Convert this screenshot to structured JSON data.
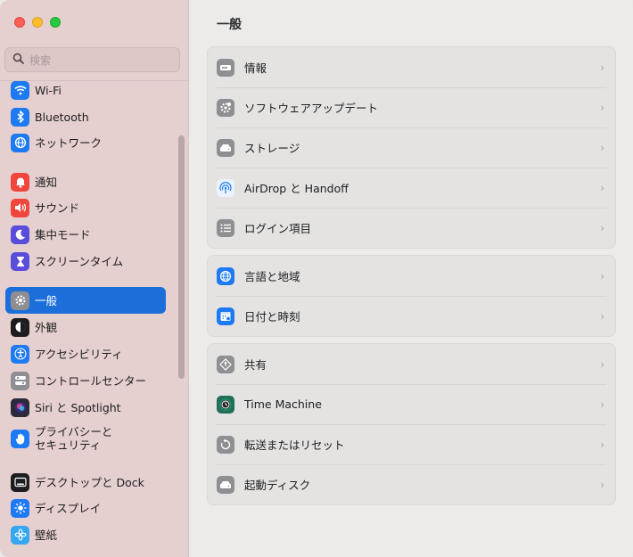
{
  "window": {
    "traffic": [
      "close",
      "minimize",
      "zoom"
    ]
  },
  "sidebar": {
    "search_placeholder": "検索",
    "items": [
      {
        "label": "Wi-Fi",
        "icon": "wifi-icon",
        "color": "#1d7af3"
      },
      {
        "label": "Bluetooth",
        "icon": "bluetooth-icon",
        "color": "#1d7af3"
      },
      {
        "label": "ネットワーク",
        "icon": "network-globe-icon",
        "color": "#1d7af3"
      },
      {
        "label": "通知",
        "icon": "bell-icon",
        "color": "#f0463c"
      },
      {
        "label": "サウンド",
        "icon": "speaker-icon",
        "color": "#f0463c"
      },
      {
        "label": "集中モード",
        "icon": "moon-icon",
        "color": "#5b4ddb"
      },
      {
        "label": "スクリーンタイム",
        "icon": "hourglass-icon",
        "color": "#5b4ddb"
      },
      {
        "label": "一般",
        "icon": "gear-icon",
        "color": "#8e8e93",
        "selected": true
      },
      {
        "label": "外観",
        "icon": "appearance-icon",
        "color": "#1d1d1f"
      },
      {
        "label": "アクセシビリティ",
        "icon": "accessibility-icon",
        "color": "#1d7af3"
      },
      {
        "label": "コントロールセンター",
        "icon": "control-center-icon",
        "color": "#8e8e93"
      },
      {
        "label": "Siri と Spotlight",
        "icon": "siri-icon",
        "color": "#7b3fe4"
      },
      {
        "label": "プライバシーと\nセキュリティ",
        "icon": "hand-icon",
        "color": "#1d7af3"
      },
      {
        "label": "デスクトップと Dock",
        "icon": "dock-icon",
        "color": "#1d1d1f"
      },
      {
        "label": "ディスプレイ",
        "icon": "sun-icon",
        "color": "#1d7af3"
      },
      {
        "label": "壁紙",
        "icon": "wallpaper-flower-icon",
        "color": "#35a7f0"
      }
    ]
  },
  "main": {
    "title": "一般",
    "groups": [
      [
        {
          "label": "情報",
          "icon": "info-device-icon"
        },
        {
          "label": "ソフトウェアアップデート",
          "icon": "software-update-gear-icon"
        },
        {
          "label": "ストレージ",
          "icon": "storage-drive-icon"
        },
        {
          "label": "AirDrop と Handoff",
          "icon": "airdrop-icon"
        },
        {
          "label": "ログイン項目",
          "icon": "login-items-list-icon"
        }
      ],
      [
        {
          "label": "言語と地域",
          "icon": "language-globe-icon"
        },
        {
          "label": "日付と時刻",
          "icon": "calendar-clock-icon"
        }
      ],
      [
        {
          "label": "共有",
          "icon": "sharing-icon"
        },
        {
          "label": "Time Machine",
          "icon": "time-machine-icon"
        },
        {
          "label": "転送またはリセット",
          "icon": "reset-arrow-icon"
        },
        {
          "label": "起動ディスク",
          "icon": "startup-disk-icon"
        }
      ]
    ],
    "chevron": "›"
  }
}
